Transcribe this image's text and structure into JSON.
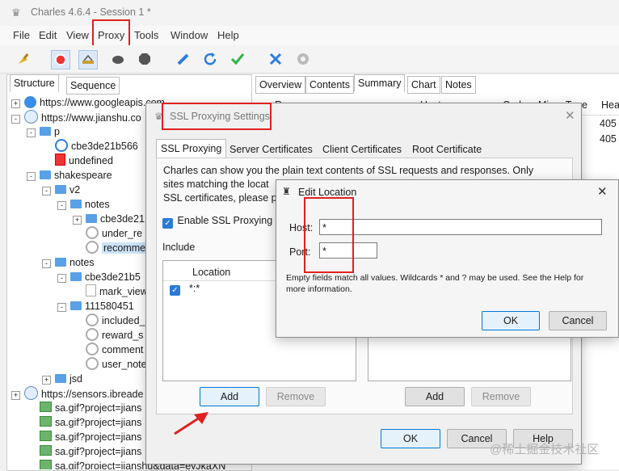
{
  "window": {
    "title": "Charles 4.6.4 - Session 1 *"
  },
  "menu": [
    "File",
    "Edit",
    "View",
    "Proxy",
    "Tools",
    "Window",
    "Help"
  ],
  "left_tabs": [
    "Structure",
    "Sequence"
  ],
  "tree": [
    {
      "indent": 0,
      "exp": "+",
      "icon": "globe",
      "label": "https://www.googleapis.com"
    },
    {
      "indent": 0,
      "exp": "-",
      "icon": "globe2",
      "label": "https://www.jianshu.co"
    },
    {
      "indent": 1,
      "exp": "-",
      "icon": "folder",
      "label": "p"
    },
    {
      "indent": 2,
      "exp": "",
      "icon": "req",
      "label": "cbe3de21b566"
    },
    {
      "indent": 2,
      "exp": "",
      "icon": "err",
      "label": "undefined"
    },
    {
      "indent": 1,
      "exp": "-",
      "icon": "folder",
      "label": "shakespeare"
    },
    {
      "indent": 2,
      "exp": "-",
      "icon": "folder",
      "label": "v2"
    },
    {
      "indent": 3,
      "exp": "-",
      "icon": "folder",
      "label": "notes"
    },
    {
      "indent": 4,
      "exp": "+",
      "icon": "folder",
      "label": "cbe3de21"
    },
    {
      "indent": 4,
      "exp": "",
      "icon": "req",
      "label": "under_re"
    },
    {
      "indent": 4,
      "exp": "",
      "icon": "req",
      "label": "recomme",
      "selected": true
    },
    {
      "indent": 2,
      "exp": "-",
      "icon": "folder",
      "label": "notes"
    },
    {
      "indent": 3,
      "exp": "-",
      "icon": "folder",
      "label": "cbe3de21b5"
    },
    {
      "indent": 4,
      "exp": "",
      "icon": "file",
      "label": "mark_view"
    },
    {
      "indent": 3,
      "exp": "-",
      "icon": "folder",
      "label": "111580451"
    },
    {
      "indent": 4,
      "exp": "",
      "icon": "req",
      "label": "included_"
    },
    {
      "indent": 4,
      "exp": "",
      "icon": "req",
      "label": "reward_s"
    },
    {
      "indent": 4,
      "exp": "",
      "icon": "req",
      "label": "comment"
    },
    {
      "indent": 4,
      "exp": "",
      "icon": "req",
      "label": "user_note"
    },
    {
      "indent": 2,
      "exp": "+",
      "icon": "folder",
      "label": "jsd"
    },
    {
      "indent": 0,
      "exp": "+",
      "icon": "globe2",
      "label": "https://sensors.ibreade"
    },
    {
      "indent": 1,
      "exp": "",
      "icon": "img",
      "label": "sa.gif?project=jians"
    },
    {
      "indent": 1,
      "exp": "",
      "icon": "img",
      "label": "sa.gif?project=jians"
    },
    {
      "indent": 1,
      "exp": "",
      "icon": "img",
      "label": "sa.gif?project=jians"
    },
    {
      "indent": 1,
      "exp": "",
      "icon": "img",
      "label": "sa.gif?project=jians"
    },
    {
      "indent": 1,
      "exp": "",
      "icon": "img",
      "label": "sa.gif?project=jianshu&data=eyJkaXN"
    }
  ],
  "right_tabs": [
    "Overview",
    "Contents",
    "Summary",
    "Chart",
    "Notes"
  ],
  "summary_header": [
    "R",
    "Host",
    "Code",
    "Mime Type",
    "Hea"
  ],
  "summary_values": [
    "405",
    "405"
  ],
  "ssl": {
    "title": "SSL Proxying Settings",
    "tabs": [
      "SSL Proxying",
      "Server Certificates",
      "Client Certificates",
      "Root Certificate"
    ],
    "desc1": "Charles can show you the plain text contents of SSL requests and responses. Only",
    "desc2": "sites matching the locat",
    "desc3": "SSL certificates, please p",
    "enable_label": "Enable SSL Proxying",
    "include_label": "Include",
    "col_location": "Location",
    "row_location": "*:*",
    "add": "Add",
    "remove": "Remove",
    "ok": "OK",
    "cancel": "Cancel",
    "help": "Help"
  },
  "edit": {
    "title": "Edit Location",
    "host_label": "Host:",
    "host_value": "*",
    "port_label": "Port:",
    "port_value": "*",
    "info1": "Empty fields match all values. Wildcards * and ? may be used. See the Help for",
    "info2": "more information.",
    "ok": "OK",
    "cancel": "Cancel"
  },
  "watermark": "@稀土掘金技术社区",
  "colors": {
    "accent": "#0078d7",
    "annotation": "#e02020",
    "selection": "#cce4f7"
  }
}
